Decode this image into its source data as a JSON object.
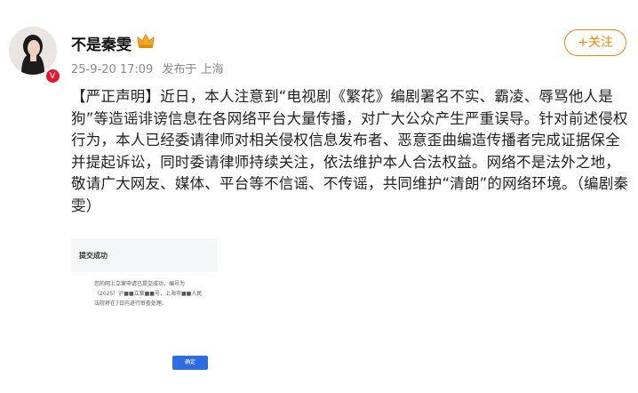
{
  "author": {
    "name": "不是秦雯",
    "badge_icon": "crown-badge-icon",
    "verified_icon": "verified-v-icon",
    "follow_label": "+关注"
  },
  "meta": {
    "time": "25-9-20 17:09",
    "source": "发布于 上海"
  },
  "post": {
    "text": "【严正声明】近日，本人注意到“电视剧《繁花》编剧署名不实、霸凌、辱骂他人是狗”等造谣诽谤信息在各网络平台大量传播，对广大公众产生严重误导。针对前述侵权行为，本人已经委请律师对相关侵权信息发布者、恶意歪曲编造传播者完成证据保全并提起诉讼，同时委请律师持续关注，依法维护本人合法权益。网络不是法外之地，敬请广大网友、媒体、平台等不信谣、不传谣，共同维护“清朗”的网络环境。（编剧秦雯）"
  },
  "attachment": {
    "title": "提交成功",
    "body": "您的网上立案申请已提交成功，编号为（2025）沪■■立案■■号，上海市■■人民法院将在7日内进行审查处理。",
    "button_label": "确定"
  },
  "colors": {
    "accent": "#ff8200",
    "verified": "#e6162d",
    "button_blue": "#2d6de0"
  }
}
